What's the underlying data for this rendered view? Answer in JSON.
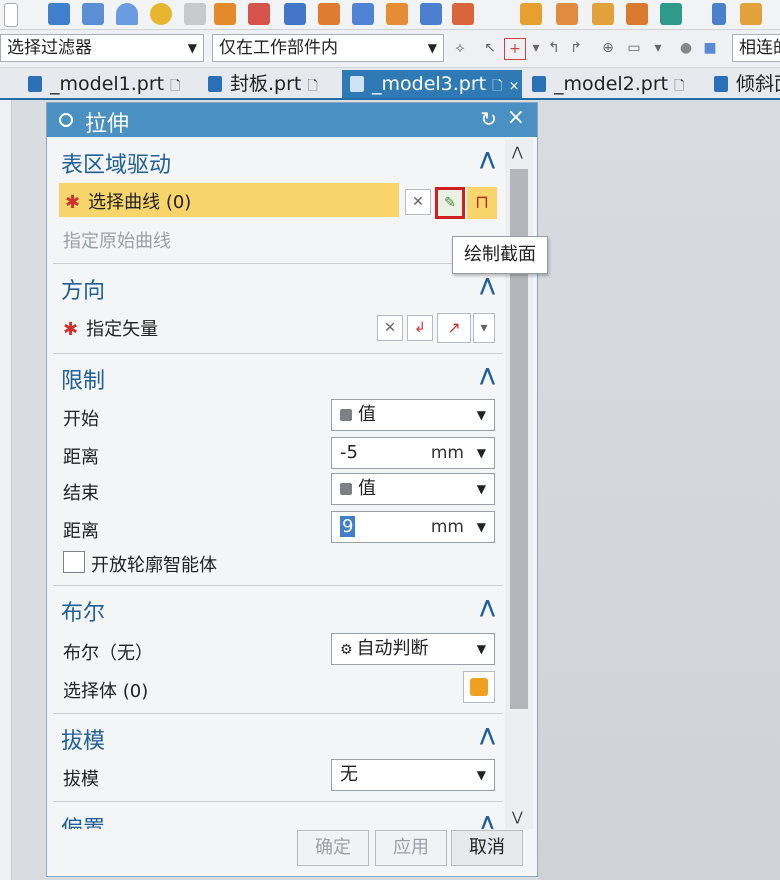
{
  "filterbar": {
    "selection_filter": "选择过滤器",
    "scope": "仅在工作部件内",
    "snap": "相连的"
  },
  "tabs": [
    {
      "label": "_model1.prt",
      "active": false
    },
    {
      "label": "封板.prt",
      "active": false
    },
    {
      "label": "_model3.prt",
      "active": true
    },
    {
      "label": "_model2.prt",
      "active": false
    },
    {
      "label": "倾斜面",
      "active": false
    }
  ],
  "dialog": {
    "title": "拉伸",
    "sections": {
      "section_drive": {
        "title": "表区域驱动",
        "select_curve": "选择曲线 (0)",
        "specify_origin": "指定原始曲线"
      },
      "direction": {
        "title": "方向",
        "specify_vector": "指定矢量"
      },
      "limits": {
        "title": "限制",
        "start_label": "开始",
        "start_value": "值",
        "start_distance_label": "距离",
        "start_distance_value": "-5",
        "start_unit": "mm",
        "end_label": "结束",
        "end_value": "值",
        "end_distance_label": "距离",
        "end_distance_value": "9",
        "end_unit": "mm",
        "open_profile": "开放轮廓智能体"
      },
      "boolean": {
        "title": "布尔",
        "boolean_label": "布尔（无）",
        "boolean_value": "自动判断",
        "select_body": "选择体 (0)"
      },
      "draft": {
        "title": "拔模",
        "draft_label": "拔模",
        "draft_value": "无"
      },
      "offset": {
        "title": "偏置"
      }
    },
    "buttons": {
      "ok": "确定",
      "apply": "应用",
      "cancel": "取消"
    }
  },
  "tooltip": "绘制截面",
  "colors": {
    "accent_blue": "#4a90c2",
    "highlight_yellow": "#f8d56b",
    "required_red": "#d0302a",
    "callout_red": "#d11f1f"
  }
}
